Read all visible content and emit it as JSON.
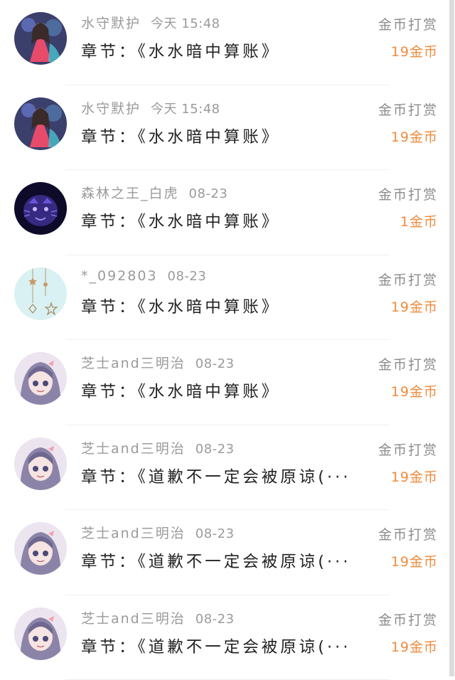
{
  "colors": {
    "meta_text": "#9a9a9a",
    "chapter_text": "#222222",
    "amount_text": "#f08a3c",
    "action_text": "#8c8c8c"
  },
  "rewards": [
    {
      "user": "水守默护",
      "time": "今天 15:48",
      "chapter": "章节：《水水暗中算账》",
      "action": "金币打赏",
      "amount": "19金币",
      "avatar": "avatar-girl-fantasy"
    },
    {
      "user": "水守默护",
      "time": "今天 15:48",
      "chapter": "章节：《水水暗中算账》",
      "action": "金币打赏",
      "amount": "19金币",
      "avatar": "avatar-girl-fantasy"
    },
    {
      "user": "森林之王_白虎",
      "time": "08-23",
      "chapter": "章节：《水水暗中算账》",
      "action": "金币打赏",
      "amount": "1金币",
      "avatar": "avatar-purple-tiger"
    },
    {
      "user": "*_092803",
      "time": "08-23",
      "chapter": "章节：《水水暗中算账》",
      "action": "金币打赏",
      "amount": "19金币",
      "avatar": "avatar-star-ornaments"
    },
    {
      "user": "芝士and三明治",
      "time": "08-23",
      "chapter": "章节：《水水暗中算账》",
      "action": "金币打赏",
      "amount": "19金币",
      "avatar": "avatar-anime-girl"
    },
    {
      "user": "芝士and三明治",
      "time": "08-23",
      "chapter": "章节：《道歉不一定会被原谅(···",
      "action": "金币打赏",
      "amount": "19金币",
      "avatar": "avatar-anime-girl"
    },
    {
      "user": "芝士and三明治",
      "time": "08-23",
      "chapter": "章节：《道歉不一定会被原谅(···",
      "action": "金币打赏",
      "amount": "19金币",
      "avatar": "avatar-anime-girl"
    },
    {
      "user": "芝士and三明治",
      "time": "08-23",
      "chapter": "章节：《道歉不一定会被原谅(···",
      "action": "金币打赏",
      "amount": "19金币",
      "avatar": "avatar-anime-girl"
    }
  ]
}
